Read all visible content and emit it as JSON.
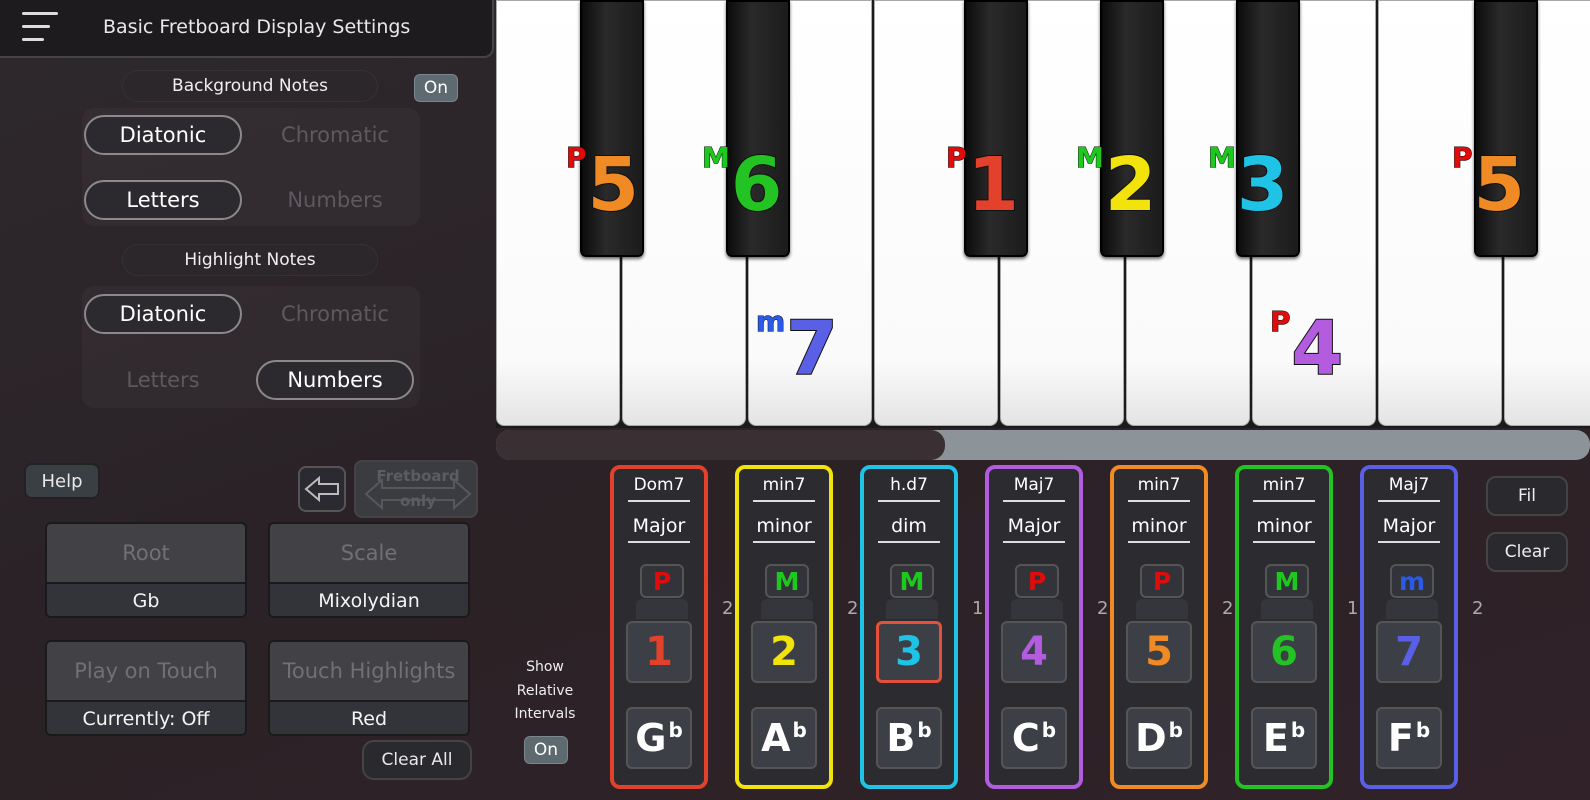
{
  "header": {
    "title": "Basic Fretboard Display Settings"
  },
  "background_notes": {
    "label": "Background Notes",
    "toggle": "On",
    "diatonic": "Diatonic",
    "chromatic": "Chromatic",
    "letters": "Letters",
    "numbers": "Numbers"
  },
  "highlight_notes": {
    "label": "Highlight Notes",
    "diatonic": "Diatonic",
    "chromatic": "Chromatic",
    "letters": "Letters",
    "numbers": "Numbers"
  },
  "controls": {
    "help": "Help",
    "fretboard_only": "Fretboard only",
    "root_label": "Root",
    "root_value": "Gb",
    "scale_label": "Scale",
    "scale_value": "Mixolydian",
    "play_label": "Play on Touch",
    "play_value": "Currently: Off",
    "touch_label": "Touch Highlights",
    "touch_value": "Red",
    "clear_all": "Clear All"
  },
  "relative": {
    "line1": "Show",
    "line2": "Relative",
    "line3": "Intervals",
    "toggle": "On"
  },
  "piano_notes": [
    {
      "pre": "P",
      "num": "5",
      "color": "#f08a24"
    },
    {
      "pre": "M",
      "num": "6",
      "color": "#22c322"
    },
    {
      "pre": "P",
      "num": "1",
      "color": "#e2412b"
    },
    {
      "pre": "M",
      "num": "2",
      "color": "#f2e30c"
    },
    {
      "pre": "M",
      "num": "3",
      "color": "#1fc3e6"
    },
    {
      "pre": "P",
      "num": "5",
      "color": "#f08a24"
    },
    {
      "pre": "m",
      "num": "7",
      "color": "#5a60e6"
    },
    {
      "pre": "P",
      "num": "4",
      "color": "#b35ce0"
    }
  ],
  "prefix_colors": {
    "P": "#e00b0b",
    "M": "#1ec91e",
    "m": "#2a5be8"
  },
  "cards": [
    {
      "quality": "Dom7",
      "mode": "Major",
      "ivtype": "P",
      "degree": "1",
      "letter": "G",
      "accidental": "b",
      "color": "#e2412b"
    },
    {
      "quality": "min7",
      "mode": "minor",
      "ivtype": "M",
      "degree": "2",
      "letter": "A",
      "accidental": "b",
      "color": "#f2e30c"
    },
    {
      "quality": "h.d7",
      "mode": "dim",
      "ivtype": "M",
      "degree": "3",
      "letter": "B",
      "accidental": "b",
      "color": "#1fc3e6"
    },
    {
      "quality": "Maj7",
      "mode": "Major",
      "ivtype": "P",
      "degree": "4",
      "letter": "C",
      "accidental": "b",
      "color": "#b35ce0"
    },
    {
      "quality": "min7",
      "mode": "minor",
      "ivtype": "P",
      "degree": "5",
      "letter": "D",
      "accidental": "b",
      "color": "#f08a24"
    },
    {
      "quality": "min7",
      "mode": "minor",
      "ivtype": "M",
      "degree": "6",
      "letter": "E",
      "accidental": "b",
      "color": "#22c322"
    },
    {
      "quality": "Maj7",
      "mode": "Major",
      "ivtype": "m",
      "degree": "7",
      "letter": "F",
      "accidental": "b",
      "color": "#5a60e6"
    }
  ],
  "steps": [
    "2",
    "2",
    "1",
    "2",
    "2",
    "1",
    "2"
  ],
  "right_buttons": {
    "fill": "Fil",
    "clear": "Clear"
  },
  "scroll_position": 0.41
}
